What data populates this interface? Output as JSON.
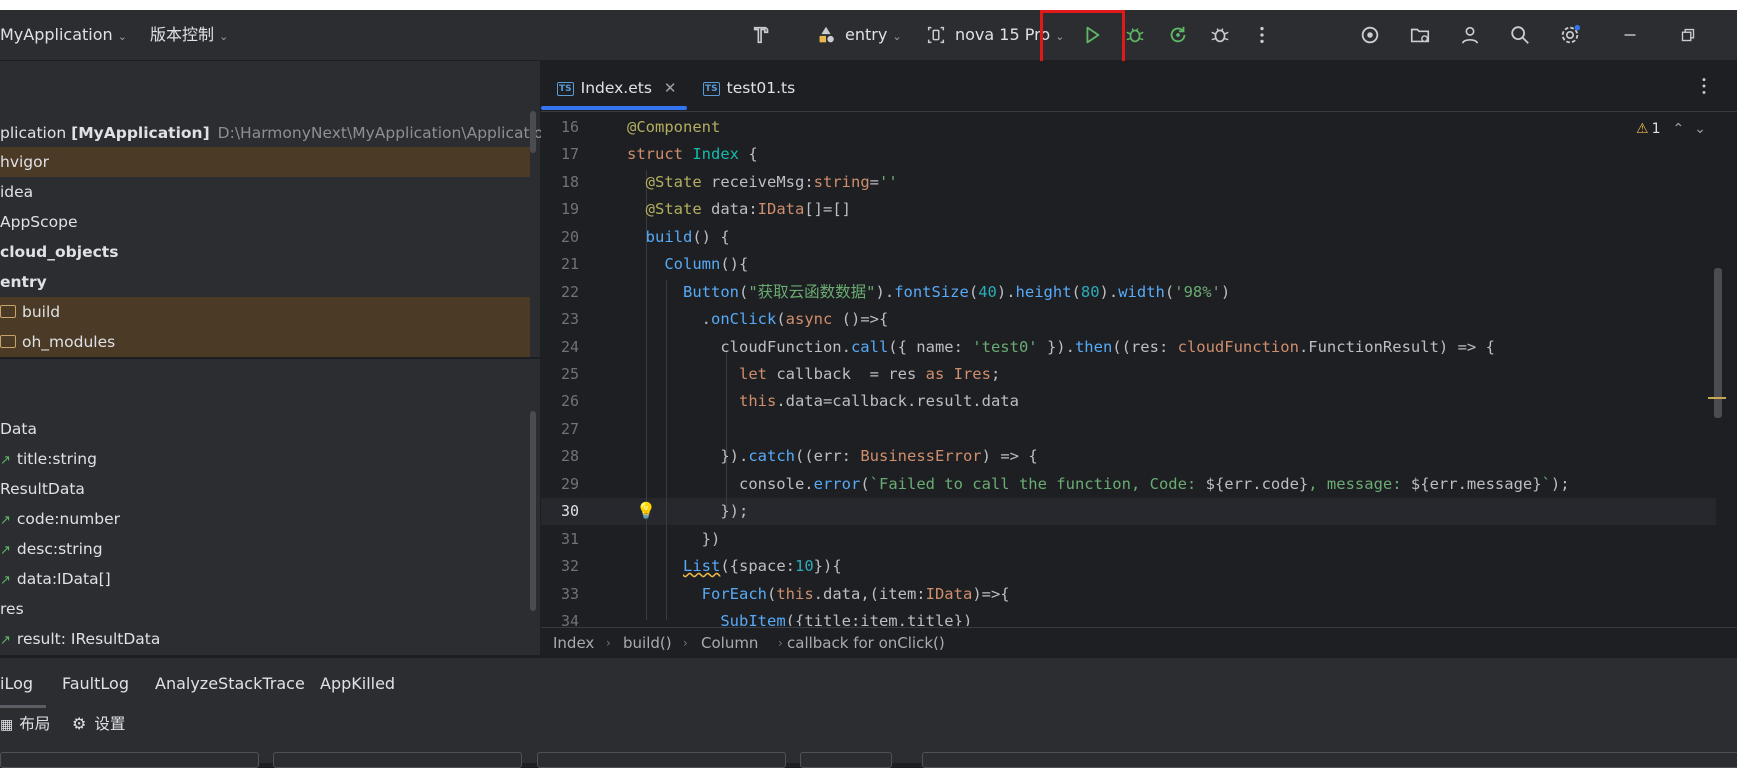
{
  "toolbar": {
    "project_name": "MyApplication",
    "vcs_menu": "版本控制",
    "module": "entry",
    "device": "nova 15 Pro"
  },
  "project_tree": {
    "root_label": "plication",
    "root_name": "[MyApplication]",
    "root_path": "D:\\HarmonyNext\\MyApplication\\Application",
    "items": [
      "hvigor",
      "idea",
      "AppScope",
      "cloud_objects",
      "entry",
      "build",
      "oh_modules"
    ]
  },
  "structure": {
    "items": [
      "Data",
      "title:string",
      "ResultData",
      "code:number",
      "desc:string",
      "data:IData[]",
      "res",
      "result: IResultData"
    ]
  },
  "editor": {
    "tabs": [
      {
        "label": "Index.ets",
        "active": true
      },
      {
        "label": "test01.ts",
        "active": false
      }
    ],
    "warning_count": "1",
    "current_line": 30,
    "line_numbers": [
      "16",
      "17",
      "18",
      "19",
      "20",
      "21",
      "22",
      "23",
      "24",
      "25",
      "26",
      "27",
      "28",
      "29",
      "30",
      "31",
      "32",
      "33",
      "34"
    ],
    "breadcrumbs": [
      "Index",
      "build()",
      "Column",
      "callback for onClick()"
    ]
  },
  "bottom_panel": {
    "tabs": [
      "iLog",
      "FaultLog",
      "AnalyzeStackTrace",
      "AppKilled"
    ],
    "layout_label": "布局",
    "settings_label": "设置"
  },
  "colors": {
    "run_highlight": "#e01a1a",
    "run_icon": "#5fb865",
    "accent": "#3574f0"
  }
}
